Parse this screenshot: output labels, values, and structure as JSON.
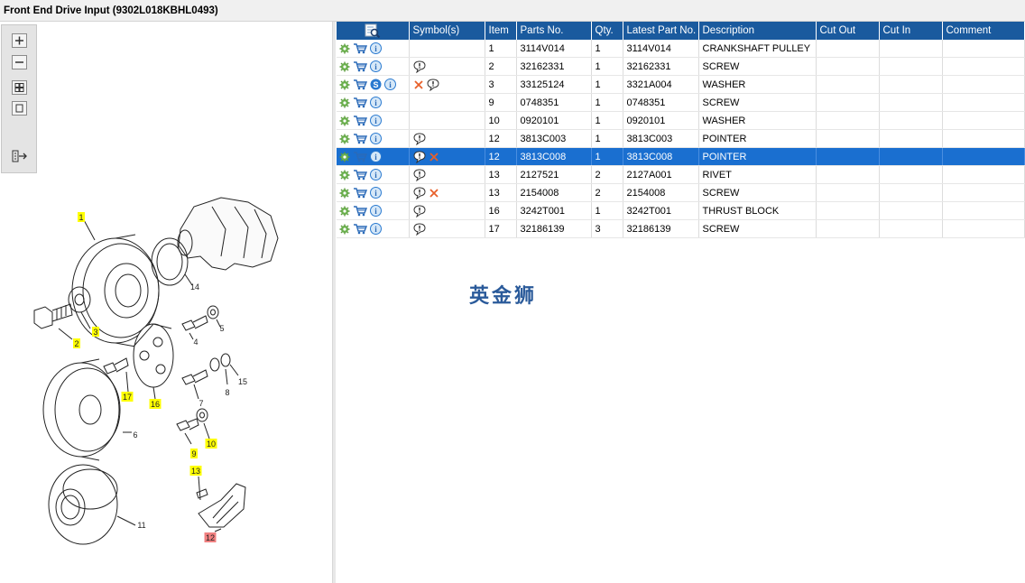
{
  "title": "Front End Drive Input (9302L018KBHL0493)",
  "watermark": "英金狮",
  "columns": {
    "symbols": "Symbol(s)",
    "item": "Item",
    "parts_no": "Parts No.",
    "qty": "Qty.",
    "latest": "Latest Part No.",
    "description": "Description",
    "cut_out": "Cut Out",
    "cut_in": "Cut In",
    "comment": "Comment"
  },
  "rows": [
    {
      "item": "1",
      "parts_no": "3114V014",
      "qty": "1",
      "latest": "3114V014",
      "description": "CRANKSHAFT PULLEY",
      "cut_out": "",
      "cut_in": "",
      "comment": "",
      "s_icon": false,
      "comment_icon": false,
      "cross_icon": false,
      "cross_first": false,
      "selected": false
    },
    {
      "item": "2",
      "parts_no": "32162331",
      "qty": "1",
      "latest": "32162331",
      "description": "SCREW",
      "cut_out": "",
      "cut_in": "",
      "comment": "",
      "s_icon": false,
      "comment_icon": true,
      "cross_icon": false,
      "cross_first": false,
      "selected": false
    },
    {
      "item": "3",
      "parts_no": "33125124",
      "qty": "1",
      "latest": "3321A004",
      "description": "WASHER",
      "cut_out": "",
      "cut_in": "",
      "comment": "",
      "s_icon": true,
      "comment_icon": true,
      "cross_icon": true,
      "cross_first": true,
      "selected": false
    },
    {
      "item": "9",
      "parts_no": "0748351",
      "qty": "1",
      "latest": "0748351",
      "description": "SCREW",
      "cut_out": "",
      "cut_in": "",
      "comment": "",
      "s_icon": false,
      "comment_icon": false,
      "cross_icon": false,
      "cross_first": false,
      "selected": false
    },
    {
      "item": "10",
      "parts_no": "0920101",
      "qty": "1",
      "latest": "0920101",
      "description": "WASHER",
      "cut_out": "",
      "cut_in": "",
      "comment": "",
      "s_icon": false,
      "comment_icon": false,
      "cross_icon": false,
      "cross_first": false,
      "selected": false
    },
    {
      "item": "12",
      "parts_no": "3813C003",
      "qty": "1",
      "latest": "3813C003",
      "description": "POINTER",
      "cut_out": "",
      "cut_in": "",
      "comment": "",
      "s_icon": false,
      "comment_icon": true,
      "cross_icon": false,
      "cross_first": false,
      "selected": false
    },
    {
      "item": "12",
      "parts_no": "3813C008",
      "qty": "1",
      "latest": "3813C008",
      "description": "POINTER",
      "cut_out": "",
      "cut_in": "",
      "comment": "",
      "s_icon": false,
      "comment_icon": true,
      "cross_icon": true,
      "cross_first": false,
      "selected": true
    },
    {
      "item": "13",
      "parts_no": "2127521",
      "qty": "2",
      "latest": "2127A001",
      "description": "RIVET",
      "cut_out": "",
      "cut_in": "",
      "comment": "",
      "s_icon": false,
      "comment_icon": true,
      "cross_icon": false,
      "cross_first": false,
      "selected": false
    },
    {
      "item": "13",
      "parts_no": "2154008",
      "qty": "2",
      "latest": "2154008",
      "description": "SCREW",
      "cut_out": "",
      "cut_in": "",
      "comment": "",
      "s_icon": false,
      "comment_icon": true,
      "cross_icon": true,
      "cross_first": false,
      "selected": false
    },
    {
      "item": "16",
      "parts_no": "3242T001",
      "qty": "1",
      "latest": "3242T001",
      "description": "THRUST BLOCK",
      "cut_out": "",
      "cut_in": "",
      "comment": "",
      "s_icon": false,
      "comment_icon": true,
      "cross_icon": false,
      "cross_first": false,
      "selected": false
    },
    {
      "item": "17",
      "parts_no": "32186139",
      "qty": "3",
      "latest": "32186139",
      "description": "SCREW",
      "cut_out": "",
      "cut_in": "",
      "comment": "",
      "s_icon": false,
      "comment_icon": true,
      "cross_icon": false,
      "cross_first": false,
      "selected": false
    }
  ],
  "drawing": {
    "callouts": [
      "1",
      "2",
      "3",
      "4",
      "5",
      "6",
      "7",
      "8",
      "9",
      "10",
      "11",
      "12",
      "13",
      "14",
      "15",
      "16",
      "17"
    ],
    "highlighted": [
      "1",
      "2",
      "3",
      "9",
      "10",
      "13",
      "16",
      "17"
    ],
    "selected": "12"
  },
  "toolbar": [
    "zoom-in-icon",
    "zoom-out-icon",
    "fit-page-icon",
    "actual-size-icon",
    "export-icon"
  ],
  "colors": {
    "header": "#1a5a9e",
    "selected_row": "#1a6fd0",
    "callout_yellow": "#ffff00",
    "callout_red": "#f08080"
  }
}
